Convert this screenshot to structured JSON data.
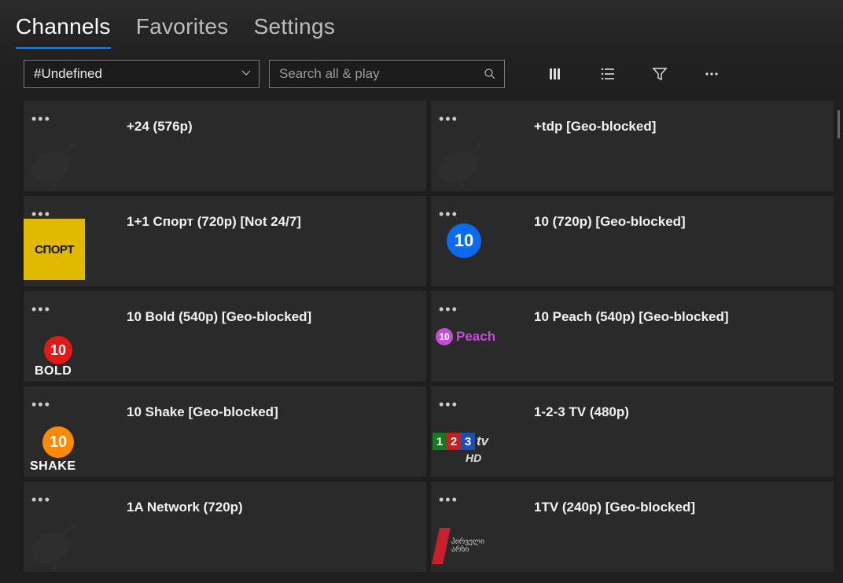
{
  "tabs": {
    "channels": "Channels",
    "favorites": "Favorites",
    "settings": "Settings"
  },
  "dropdown": {
    "value": "#Undefined"
  },
  "search": {
    "placeholder": "Search all & play"
  },
  "channels": [
    {
      "title": "+24 (576p)",
      "thumb": "dish"
    },
    {
      "title": "+tdp [Geo-blocked]",
      "thumb": "dish"
    },
    {
      "title": "1+1 Спорт (720p) [Not 24/7]",
      "thumb": "sport",
      "thumb_text": "СПОРТ"
    },
    {
      "title": "10 (720p) [Geo-blocked]",
      "thumb": "ten-blue",
      "thumb_text": "10"
    },
    {
      "title": "10 Bold (540p) [Geo-blocked]",
      "thumb": "ten-bold",
      "thumb_text": "10",
      "sub_text": "BOLD"
    },
    {
      "title": "10 Peach (540p) [Geo-blocked]",
      "thumb": "peach",
      "thumb_text": "10",
      "sub_text": "Peach"
    },
    {
      "title": "10 Shake [Geo-blocked]",
      "thumb": "ten-shake",
      "thumb_text": "10",
      "sub_text": "SHAKE"
    },
    {
      "title": "1-2-3 TV (480p)",
      "thumb": "123tv",
      "sub_text": "HD"
    },
    {
      "title": "1A Network (720p)",
      "thumb": "dish"
    },
    {
      "title": "1TV (240p) [Geo-blocked]",
      "thumb": "georgian",
      "sub_text": "პირველი\nარხი"
    }
  ]
}
